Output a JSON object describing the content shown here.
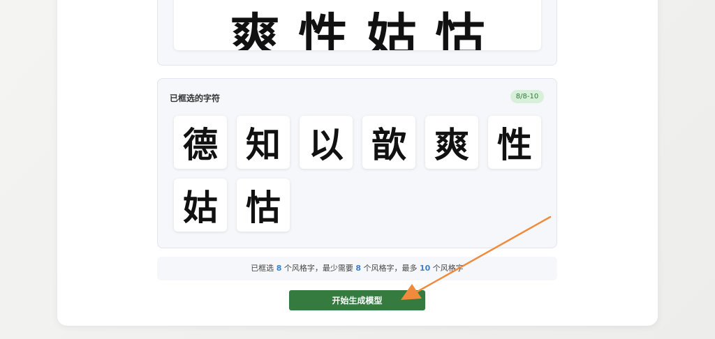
{
  "preview": {
    "chars": [
      "爽",
      "性",
      "姑",
      "怙"
    ]
  },
  "selected": {
    "title": "已框选的字符",
    "badge": "8/8-10",
    "chars": [
      "德",
      "知",
      "以",
      "歆",
      "爽",
      "性",
      "姑",
      "怙"
    ]
  },
  "info": {
    "part1": "已框选 ",
    "selected_count": "8",
    "part2": " 个风格字，最少需要 ",
    "min_count": "8",
    "part3": " 个风格字，最多 ",
    "max_count": "10",
    "part4": " 个风格字"
  },
  "actions": {
    "start_label": "开始生成模型"
  },
  "colors": {
    "accent_green": "#357a3e",
    "badge_bg": "#d8efda",
    "number_blue": "#3a7fd0",
    "annotation_arrow": "#f08a3c"
  }
}
